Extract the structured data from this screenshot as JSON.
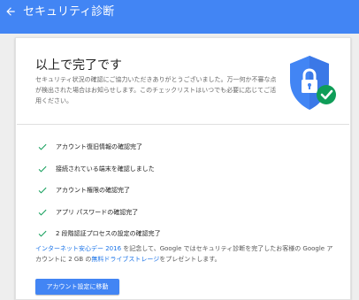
{
  "header": {
    "title": "セキュリティ診断",
    "back_icon": "arrow-back-icon"
  },
  "card": {
    "title": "以上で完了です",
    "description": "セキュリティ状況の確認にご協力いただきありがとうございました。万一何か不審な点が検出された場合はお知らせします。このチェックリストはいつでも必要に応じてご活用ください。",
    "checklist": [
      "アカウント復旧情報の確認完了",
      "接続されている端末を確認しました",
      "アカウント権限の確認完了",
      "アプリ パスワードの確認完了",
      "2 段階認証プロセスの設定の確認完了"
    ],
    "promo": {
      "link1": "インターネット安心デー 2016",
      "text1": " を記念して、Google ではセキュリティ診断を完了したお客様の Google アカウントに 2 GB の",
      "link2": "無料ドライブストレージ",
      "text2": "をプレゼントします。"
    },
    "cta_label": "アカウント設定に移動"
  },
  "colors": {
    "appbar": "#4285f4",
    "check": "#0f9d58",
    "shield": "#4285f4",
    "badge": "#0f9d58",
    "link": "#1a73e8"
  }
}
